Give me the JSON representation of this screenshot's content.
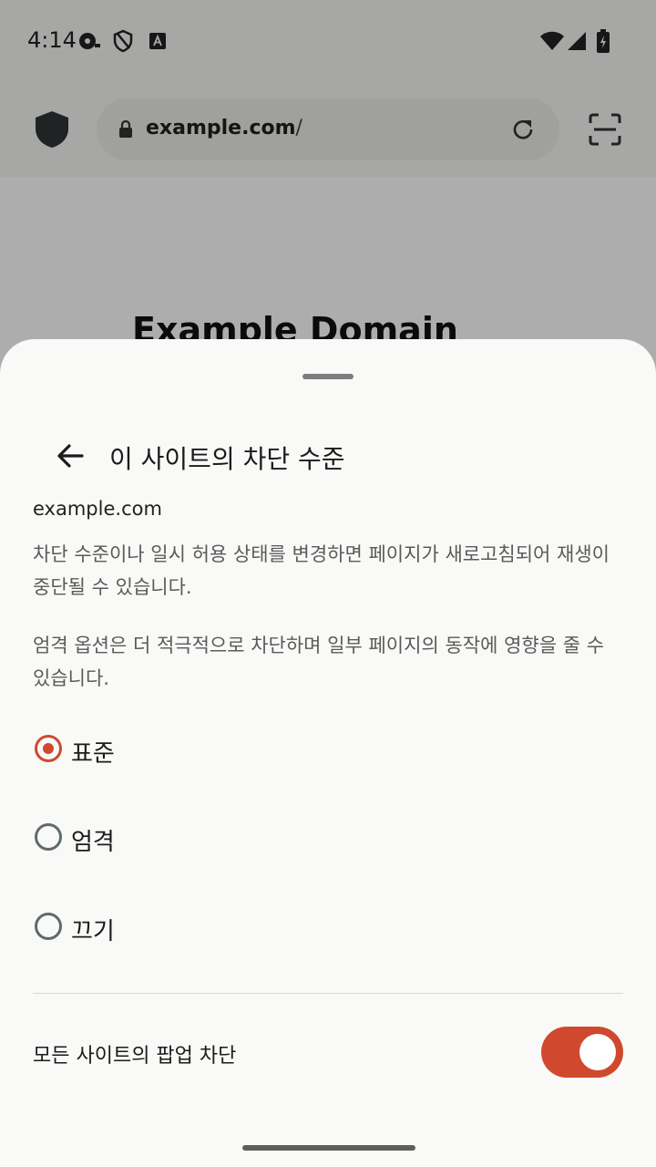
{
  "status_bar": {
    "time": "4:14"
  },
  "browser": {
    "url_host": "example.com",
    "url_path": "/",
    "page_heading": "Example Domain"
  },
  "sheet": {
    "title": "이 사이트의 차단 수준",
    "site": "example.com",
    "description_1": "차단 수준이나 일시 허용 상태를 변경하면 페이지가 새로고침되어 재생이 중단될 수 있습니다.",
    "description_2": "엄격 옵션은 더 적극적으로 차단하며 일부 페이지의 동작에 영향을 줄 수 있습니다.",
    "options": [
      {
        "label": "표준",
        "selected": true
      },
      {
        "label": "엄격",
        "selected": false
      },
      {
        "label": "끄기",
        "selected": false
      }
    ],
    "popup_block_label": "모든 사이트의 팝업 차단",
    "popup_block_enabled": true
  },
  "colors": {
    "accent": "#d0492e",
    "sheet_bg": "#f9f9f7",
    "radio_unselected": "#5f6b6a"
  },
  "icons": {
    "shield": "shield-icon",
    "lock": "lock-icon",
    "reload": "reload-icon",
    "scan": "qr-scan-icon",
    "back": "arrow-back-icon"
  }
}
